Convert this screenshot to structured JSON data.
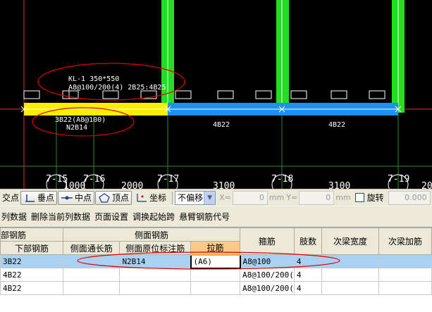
{
  "canvas": {
    "beam_annotation": {
      "line1": "KL-1 350*550",
      "line2": "A8@100/200(4) 2B25:4B25"
    },
    "span1_bottom_bars": {
      "line1": "3B22(A8@100)",
      "line2": "N2B14"
    },
    "span2_bottom_bars": "4B22",
    "span3_bottom_bars": "4B22",
    "axis_labels": [
      "7-15",
      "7-16",
      "7-17",
      "7-18",
      "7-19"
    ],
    "dimensions": [
      "1000",
      "2000",
      "3100",
      "3100",
      "20"
    ],
    "colors": {
      "background": "#000000",
      "column": "#22dd22",
      "current_span": "#ffee00",
      "beam_span": "#2090f0",
      "axis_line": "#ff2020",
      "highlight_ellipse": "#dd0000"
    }
  },
  "snap_toolbar": {
    "label_intersection": "交点",
    "btn_perpendicular": "垂点",
    "btn_midpoint": "中点",
    "btn_vertex": "顶点",
    "btn_coordinate": "坐标",
    "offset_mode": "不偏移",
    "x_label": "X=",
    "x_value": "0",
    "x_unit": "mm",
    "y_label": "Y=",
    "y_value": "0",
    "y_unit": "mm",
    "rotate_label": "旋转",
    "rotate_value": "0.000"
  },
  "menu": {
    "items": [
      "列数据",
      "删除当前列数据",
      "页面设置",
      "调换起始跨",
      "悬臂钢筋代号"
    ]
  },
  "table": {
    "group_headers": {
      "bottom_rebar": "部钢筋",
      "side_rebar": "侧面钢筋"
    },
    "columns": {
      "bottom_rebar": "下部钢筋",
      "side_through": "侧面通长筋",
      "side_origin": "侧面原位标注筋",
      "tie_bar": "拉筋",
      "stirrup": "箍筋",
      "legs": "肢数",
      "secondary_beam_width": "次梁宽度",
      "secondary_beam_extra": "次梁加筋"
    },
    "rows": [
      {
        "bottom_rebar": "3B22",
        "side_through": "",
        "side_origin": "N2B14",
        "tie_bar": "(A6)",
        "stirrup": "A8@100",
        "legs": "4",
        "secondary_beam_width": "",
        "secondary_beam_extra": ""
      },
      {
        "bottom_rebar": "4B22",
        "side_through": "",
        "side_origin": "",
        "tie_bar": "",
        "stirrup": "A8@100/200(",
        "legs": "4",
        "secondary_beam_width": "",
        "secondary_beam_extra": ""
      },
      {
        "bottom_rebar": "4B22",
        "side_through": "",
        "side_origin": "",
        "tie_bar": "",
        "stirrup": "A8@100/200(",
        "legs": "4",
        "secondary_beam_width": "",
        "secondary_beam_extra": ""
      }
    ]
  }
}
